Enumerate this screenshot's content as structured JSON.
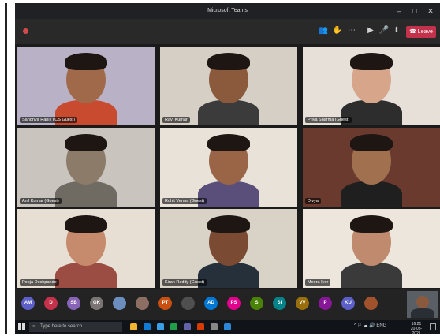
{
  "window": {
    "title": "Microsoft Teams",
    "controls": [
      "–",
      "□",
      "✕"
    ]
  },
  "toolbar": {
    "timer": "",
    "icons": [
      "people-icon",
      "chat-icon",
      "more-icon",
      "camera-icon",
      "mic-icon",
      "share-icon"
    ],
    "leave_label": "Leave"
  },
  "participants": [
    {
      "name": "Sandhya Rani (TCS Guest)",
      "skin": "#a06a4a",
      "bg": "#b9b1c6",
      "shirt": "#c94b2f"
    },
    {
      "name": "Ravi Kumar",
      "skin": "#8b5a3c",
      "bg": "#d6cfc5",
      "shirt": "#3b3b3b"
    },
    {
      "name": "Priya Sharma (Guest)",
      "skin": "#d7a58a",
      "bg": "#e6e0d8",
      "shirt": "#2d2d2d"
    },
    {
      "name": "Anil Kumar (Guest)",
      "skin": "#8c7b68",
      "bg": "#c9c4be",
      "shirt": "#6f6a62"
    },
    {
      "name": "Rohit Verma (Guest)",
      "skin": "#9a6446",
      "bg": "#e8e2d9",
      "shirt": "#5a4f7a"
    },
    {
      "name": "Divya",
      "skin": "#a1704f",
      "bg": "#6b3a2f",
      "shirt": "#1f1f1f"
    },
    {
      "name": "Pooja Deshpande",
      "skin": "#c68a6c",
      "bg": "#e7dfd3",
      "shirt": "#9b4d44"
    },
    {
      "name": "Kiran Reddy (Guest)",
      "skin": "#7a4a32",
      "bg": "#d9d2c7",
      "shirt": "#25303b"
    },
    {
      "name": "Meera Iyer",
      "skin": "#c08a6e",
      "bg": "#ece6dc",
      "shirt": "#3a3a3a"
    }
  ],
  "avatars": [
    {
      "initials": "AM",
      "color": "#5b5fc7"
    },
    {
      "initials": "D",
      "color": "#c4314b"
    },
    {
      "initials": "SB",
      "color": "#8764b8"
    },
    {
      "initials": "GK",
      "color": "#7a7574"
    },
    {
      "initials": "",
      "color": "#6c8ebf"
    },
    {
      "initials": "",
      "color": "#8d6e63"
    },
    {
      "initials": "PT",
      "color": "#ca5010"
    },
    {
      "initials": "",
      "color": "#4f4f4f"
    },
    {
      "initials": "AD",
      "color": "#0078d4"
    },
    {
      "initials": "PS",
      "color": "#e3008c"
    },
    {
      "initials": "S",
      "color": "#498205"
    },
    {
      "initials": "SI",
      "color": "#038387"
    },
    {
      "initials": "VV",
      "color": "#986f0b"
    },
    {
      "initials": "P",
      "color": "#881798"
    },
    {
      "initials": "KU",
      "color": "#5b5fc7"
    },
    {
      "initials": "",
      "color": "#a0522d"
    }
  ],
  "taskbar": {
    "search_placeholder": "Type here to search",
    "apps": [
      "#f3b42f",
      "#0f7bd4",
      "#3aa0e6",
      "#1f9e4a",
      "#6264a7",
      "#d83b01",
      "#8a8886",
      "#2b88d8"
    ],
    "tray": "^ ⚐ ☁ 🔊 ENG",
    "time": "16:21",
    "date": "20-08-2021"
  }
}
